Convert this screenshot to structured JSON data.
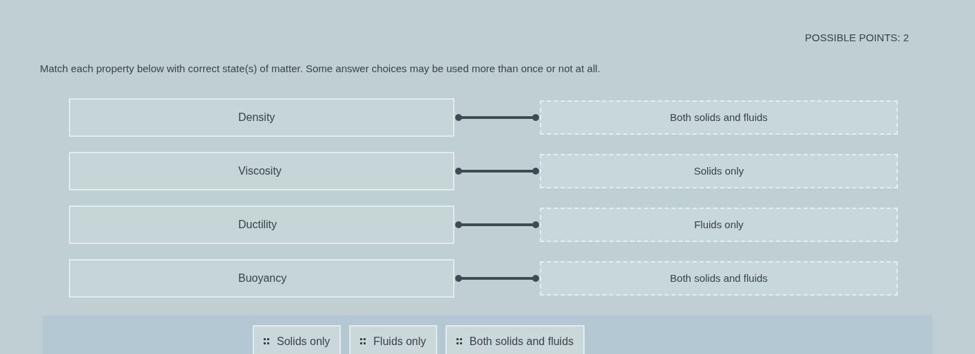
{
  "points": "POSSIBLE POINTS: 2",
  "instructions": "Match each property below with correct state(s) of matter. Some answer choices may be used more than once or not at all.",
  "pairs": [
    {
      "prompt": "Density",
      "answer": "Both solids and fluids"
    },
    {
      "prompt": "Viscosity",
      "answer": "Solids only"
    },
    {
      "prompt": "Ductility",
      "answer": "Fluids only"
    },
    {
      "prompt": "Buoyancy",
      "answer": "Both solids and fluids"
    }
  ],
  "choices": [
    "Solids only",
    "Fluids only",
    "Both solids and fluids"
  ]
}
